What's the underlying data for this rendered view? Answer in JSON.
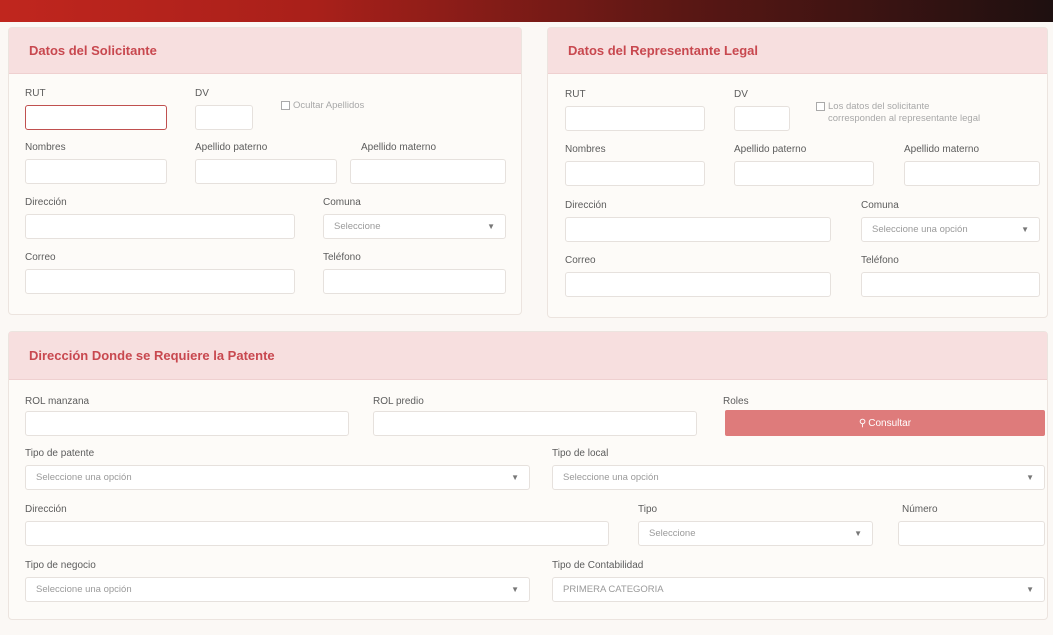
{
  "solicitante": {
    "title": "Datos del Solicitante",
    "rut_label": "RUT",
    "dv_label": "DV",
    "ocultar_label": "Ocultar Apellidos",
    "nombres_label": "Nombres",
    "apellido_paterno_label": "Apellido paterno",
    "apellido_materno_label": "Apellido materno",
    "direccion_label": "Dirección",
    "comuna_label": "Comuna",
    "comuna_value": "Seleccione",
    "correo_label": "Correo",
    "telefono_label": "Teléfono"
  },
  "representante": {
    "title": "Datos del Representante Legal",
    "rut_label": "RUT",
    "dv_label": "DV",
    "check_line1": "Los datos del solicitante",
    "check_line2": "corresponden al representante legal",
    "nombres_label": "Nombres",
    "apellido_paterno_label": "Apellido paterno",
    "apellido_materno_label": "Apellido materno",
    "direccion_label": "Dirección",
    "comuna_label": "Comuna",
    "comuna_value": "Seleccione una opción",
    "correo_label": "Correo",
    "telefono_label": "Teléfono"
  },
  "patente": {
    "title": "Dirección Donde se Requiere la Patente",
    "rol_manzana_label": "ROL manzana",
    "rol_predio_label": "ROL predio",
    "roles_label": "Roles",
    "consultar_label": "Consultar",
    "tipo_patente_label": "Tipo de patente",
    "tipo_patente_value": "Seleccione una opción",
    "tipo_local_label": "Tipo de local",
    "tipo_local_value": "Seleccione una opción",
    "direccion_label": "Dirección",
    "tipo_label": "Tipo",
    "tipo_value": "Seleccione",
    "numero_label": "Número",
    "tipo_negocio_label": "Tipo de negocio",
    "tipo_negocio_value": "Seleccione una opción",
    "tipo_contabilidad_label": "Tipo de Contabilidad",
    "tipo_contabilidad_value": "PRIMERA CATEGORIA"
  },
  "icons": {
    "select_caret": "chevron-down-icon",
    "consultar": "search-icon"
  }
}
